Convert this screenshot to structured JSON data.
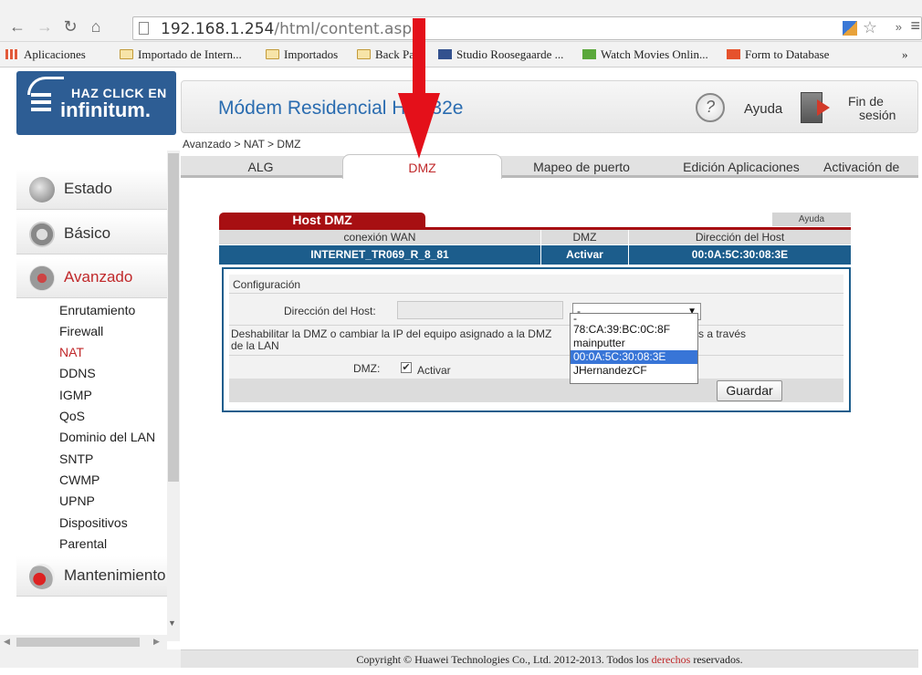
{
  "browser": {
    "url_host": "192.168.1.254",
    "url_path": "/html/content.asp",
    "bookmarks": [
      {
        "label": "Aplicaciones",
        "icon": "apps-grid-icon"
      },
      {
        "label": "Importado de Intern...",
        "icon": "folder-icon"
      },
      {
        "label": "Importados",
        "icon": "folder-icon"
      },
      {
        "label": "Back Pa",
        "icon": "folder-icon"
      },
      {
        "label": "Studio Roosegaarde ...",
        "icon": "site-favicon-icon"
      },
      {
        "label": "Watch Movies Onlin...",
        "icon": "site-favicon-icon"
      },
      {
        "label": "Form to Database",
        "icon": "site-favicon-icon"
      }
    ],
    "more_label": "»"
  },
  "header": {
    "logo_top": "HAZ CLICK EN",
    "logo_bottom": "infinitum.",
    "title": "Módem Residencial HG532e",
    "help_label": "Ayuda",
    "logout_line1": "Fin de",
    "logout_line2": "sesión"
  },
  "breadcrumb": "Avanzado > NAT > DMZ",
  "tabs": [
    {
      "label": "ALG"
    },
    {
      "label": "DMZ",
      "active": true
    },
    {
      "label": "Mapeo de puerto"
    },
    {
      "label": "Edición Aplicaciones"
    },
    {
      "label": "Activación de"
    }
  ],
  "sidebar": {
    "sections": [
      {
        "label": "Estado",
        "icon": "status-icon"
      },
      {
        "label": "Básico",
        "icon": "basic-gear-icon"
      },
      {
        "label": "Avanzado",
        "icon": "advanced-gear-icon",
        "active": true
      },
      {
        "label": "Mantenimiento",
        "icon": "maintenance-tools-icon"
      }
    ],
    "submenu": [
      "Enrutamiento",
      "Firewall",
      "NAT",
      "DDNS",
      "IGMP",
      "QoS",
      "Dominio del LAN",
      "SNTP",
      "CWMP",
      "UPNP",
      "Dispositivos",
      "Parental"
    ],
    "active_submenu": "NAT"
  },
  "host_dmz": {
    "tab_label": "Host DMZ",
    "help_label": "Ayuda",
    "columns": [
      "conexión WAN",
      "DMZ",
      "Dirección del Host"
    ],
    "rows": [
      [
        "INTERNET_TR069_R_8_81",
        "Activar",
        "00:0A:5C:30:08:3E"
      ]
    ]
  },
  "config": {
    "title": "Configuración",
    "host_label": "Dirección del Host:",
    "host_input_value": "",
    "host_select_value": "-",
    "host_options": [
      "-",
      "78:CA:39:BC:0C:8F",
      "mainputter",
      "00:0A:5C:30:08:3E",
      "JHernandezCF"
    ],
    "selected_option": "00:0A:5C:30:08:3E",
    "desc_start": "Deshabilitar la DMZ o cambiar la IP del equipo asignado a la DMZ",
    "desc_end": "iones realizadas a través",
    "desc_line2": "de la LAN",
    "dmz_label": "DMZ:",
    "dmz_check_label": "Activar",
    "dmz_checked": true,
    "save_label": "Guardar"
  },
  "footer": {
    "prefix": "Copyright © Huawei Technologies Co., Ltd. 2012-2013. Todos los",
    "link": "derechos",
    "suffix": "reservados."
  },
  "colors": {
    "brand_blue": "#2d5d94",
    "accent_red": "#c0282a",
    "table_blue": "#1c5d8c",
    "annotation_arrow": "#e4101a"
  }
}
